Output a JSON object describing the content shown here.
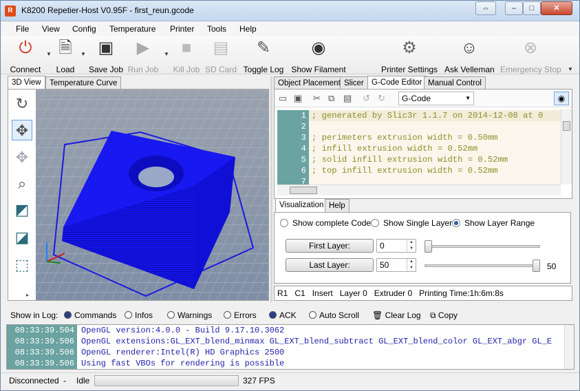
{
  "window": {
    "title": "K8200 Repetier-Host V0.95F - first_reun.gcode",
    "app_icon": "R"
  },
  "menu": [
    "File",
    "View",
    "Config",
    "Temperature",
    "Printer",
    "Tools",
    "Help"
  ],
  "toolbar": {
    "connect": "Connect",
    "load": "Load",
    "save_job": "Save Job",
    "run_job": "Run Job",
    "kill_job": "Kill Job",
    "sd_card": "SD Card",
    "toggle_log": "Toggle Log",
    "show_filament": "Show Filament",
    "printer_settings": "Printer Settings",
    "ask_velleman": "Ask Velleman",
    "emergency_stop": "Emergency Stop"
  },
  "left_tabs": [
    "3D View",
    "Temperature Curve"
  ],
  "right_tabs": [
    "Object Placement",
    "Slicer",
    "G-Code Editor",
    "Manual Control"
  ],
  "gcode": {
    "mode": "G-Code",
    "lines": [
      {
        "n": "1",
        "text": "; generated by Slic3r 1.1.7 on 2014-12-08 at 0"
      },
      {
        "n": "2",
        "text": ""
      },
      {
        "n": "3",
        "text": "; perimeters extrusion width = 0.50mm"
      },
      {
        "n": "4",
        "text": "; infill extrusion width = 0.52mm"
      },
      {
        "n": "5",
        "text": "; solid infill extrusion width = 0.52mm"
      },
      {
        "n": "6",
        "text": "; top infill extrusion width = 0.52mm"
      },
      {
        "n": "7",
        "text": ""
      }
    ]
  },
  "viz": {
    "tabs": [
      "Visualization",
      "Help"
    ],
    "opt_complete": "Show complete Code",
    "opt_single": "Show Single Layer",
    "opt_range": "Show Layer Range",
    "selected": "Show Layer Range",
    "first_label": "First Layer:",
    "first_value": "0",
    "last_label": "Last Layer:",
    "last_value": "50",
    "last_slider_value": "50",
    "first_level": 0.0,
    "last_level": 1.0
  },
  "editor_status": {
    "r": "R1",
    "c": "C1",
    "mode": "Insert",
    "layer": "Layer 0",
    "extruder": "Extruder 0",
    "printing_time": "Printing Time:1h:6m:8s"
  },
  "log": {
    "show_label": "Show in Log:",
    "filters": [
      "Commands",
      "Infos",
      "Warnings",
      "Errors",
      "ACK",
      "Auto Scroll"
    ],
    "clear": "Clear Log",
    "copy": "Copy",
    "rows": [
      {
        "ts": "08:33:39.504",
        "msg": "OpenGL version:4.0.0 - Build 9.17.10.3062"
      },
      {
        "ts": "08:33:39.506",
        "msg": "OpenGL extensions:GL_EXT_blend_minmax GL_EXT_blend_subtract GL_EXT_blend_color GL_EXT_abgr GL_E"
      },
      {
        "ts": "08:33:39.506",
        "msg": "OpenGL renderer:Intel(R) HD Graphics 2500"
      },
      {
        "ts": "08:33:39.506",
        "msg": "Using fast VBOs for rendering is possible"
      }
    ]
  },
  "status": {
    "connection": "Disconnected",
    "sep": "-",
    "state": "Idle",
    "fps": "327 FPS"
  },
  "colors": {
    "object_blue": "#1212e8",
    "grid_bg": "#8f9aaa",
    "line_number_teal": "#6aa3a1",
    "gcode_text": "#8b8f2a",
    "log_text": "#2222aa"
  }
}
